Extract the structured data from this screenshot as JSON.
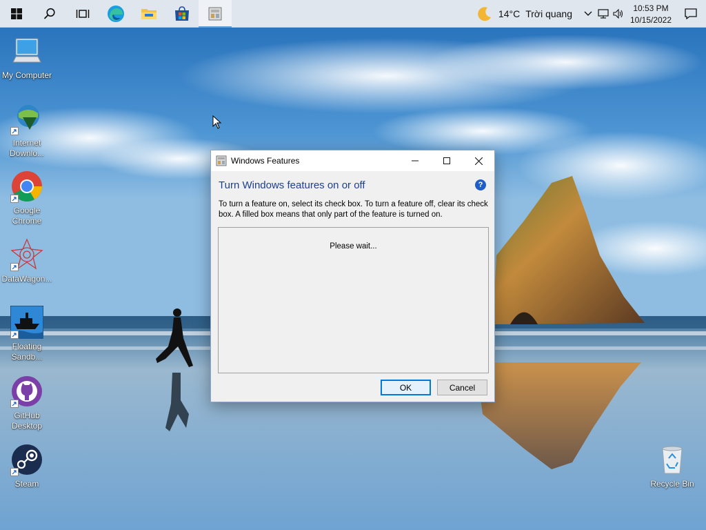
{
  "taskbar": {
    "buttons": [
      {
        "name": "start-button",
        "icon": "windows-logo-icon"
      },
      {
        "name": "search-button",
        "icon": "search-icon"
      },
      {
        "name": "task-view-button",
        "icon": "task-view-icon"
      },
      {
        "name": "edge-button",
        "icon": "edge-icon"
      },
      {
        "name": "file-explorer-button",
        "icon": "folder-icon"
      },
      {
        "name": "store-button",
        "icon": "store-icon"
      },
      {
        "name": "windows-features-taskbar-button",
        "icon": "windows-features-icon",
        "active": true
      }
    ],
    "weather": {
      "icon": "moon-icon",
      "temperature": "14°C",
      "condition": "Trời quang"
    },
    "tray_icons": [
      "chevron-up-icon",
      "network-icon",
      "volume-icon"
    ],
    "clock": {
      "time": "10:53 PM",
      "date": "10/15/2022"
    },
    "notification_icon": "notification-icon"
  },
  "desktop": {
    "icons": [
      {
        "name": "my-computer",
        "label": "My Computer",
        "icon": "computer-icon",
        "shortcut": false
      },
      {
        "name": "internet-download-manager",
        "label": "Internet Downlo...",
        "icon": "idm-icon",
        "shortcut": true
      },
      {
        "name": "google-chrome",
        "label": "Google Chrome",
        "icon": "chrome-icon",
        "shortcut": true
      },
      {
        "name": "datawagon",
        "label": "DataWagon...",
        "icon": "datawagon-icon",
        "shortcut": true
      },
      {
        "name": "floating-sandbox",
        "label": "Floating Sandb...",
        "icon": "ship-icon",
        "shortcut": true
      },
      {
        "name": "github-desktop",
        "label": "GitHub Desktop",
        "icon": "github-icon",
        "shortcut": true
      },
      {
        "name": "steam",
        "label": "Steam",
        "icon": "steam-icon",
        "shortcut": true
      },
      {
        "name": "recycle-bin",
        "label": "Recycle Bin",
        "icon": "recycle-bin-icon",
        "shortcut": false
      }
    ]
  },
  "dialog": {
    "title": "Windows Features",
    "heading": "Turn Windows features on or off",
    "description": "To turn a feature on, select its check box. To turn a feature off, clear its check box. A filled box means that only part of the feature is turned on.",
    "status": "Please wait...",
    "help_label": "?",
    "ok_label": "OK",
    "cancel_label": "Cancel"
  },
  "colors": {
    "taskbar": "#dfe6ee",
    "dialog_heading": "#1c3e93",
    "accent": "#0078d7"
  }
}
